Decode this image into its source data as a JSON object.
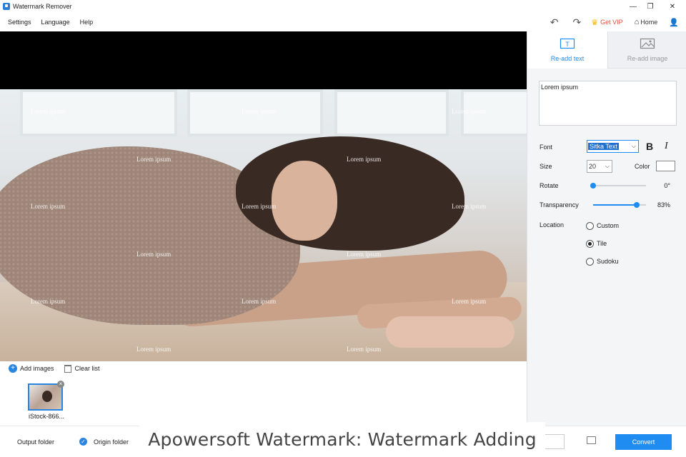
{
  "window": {
    "title": "Watermark Remover",
    "controls": {
      "minimize": "—",
      "restore": "❐",
      "close": "✕"
    }
  },
  "menu": {
    "items": [
      "Settings",
      "Language",
      "Help"
    ]
  },
  "toolbar": {
    "undo": "↶",
    "redo": "↷",
    "get_vip": "Get VIP",
    "home": "Home",
    "user": "👤"
  },
  "preview": {
    "watermark_text": "Lorem ipsum"
  },
  "image_list": {
    "add_images": "Add images",
    "clear_list": "Clear list",
    "thumbnail_name": "iStock-866...",
    "thumbnail_close": "×"
  },
  "side_panel": {
    "tabs": [
      {
        "label": "Re-add text",
        "active": true
      },
      {
        "label": "Re-add image",
        "active": false
      }
    ],
    "text_input_value": "Lorem ipsum",
    "font": {
      "label": "Font",
      "value": "Sitka Text",
      "bold": "B",
      "italic": "I"
    },
    "size": {
      "label": "Size",
      "value": "20"
    },
    "color": {
      "label": "Color",
      "value": "#ffffff"
    },
    "rotate": {
      "label": "Rotate",
      "value_text": "0°",
      "value": 0,
      "max": 360
    },
    "transparency": {
      "label": "Transparency",
      "value_text": "83%",
      "value": 83,
      "max": 100
    },
    "location": {
      "label": "Location",
      "options": [
        {
          "label": "Custom",
          "selected": false
        },
        {
          "label": "Tile",
          "selected": true
        },
        {
          "label": "Sudoku",
          "selected": false
        }
      ]
    }
  },
  "bottom": {
    "output_folder": "Output folder",
    "origin_folder": "Origin folder",
    "convert": "Convert",
    "check": "✓"
  },
  "caption": "Apowersoft Watermark: Watermark Adding",
  "colors": {
    "accent": "#1e8cf0",
    "vip": "#e0503a"
  }
}
